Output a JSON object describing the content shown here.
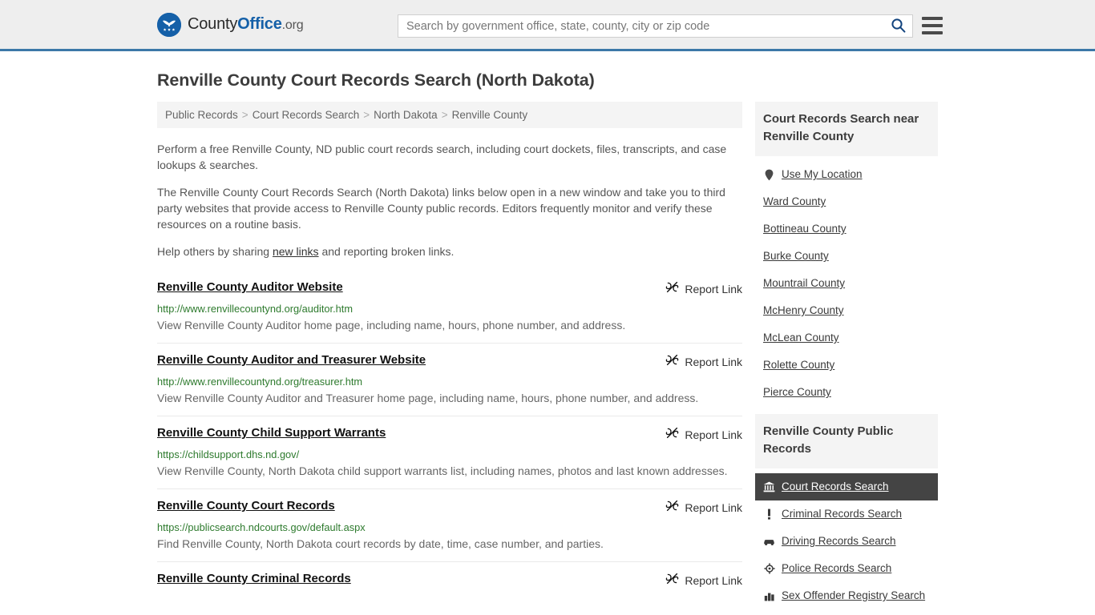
{
  "header": {
    "logo": {
      "icon": "eagle-seal-icon",
      "part1": "County",
      "part2": "Office",
      "part3": ".org"
    },
    "search": {
      "placeholder": "Search by government office, state, county, city or zip code",
      "value": "",
      "search_icon": "search-icon"
    },
    "menu_icon": "hamburger-menu-icon",
    "accent_color": "#3c78a8"
  },
  "page": {
    "title": "Renville County Court Records Search (North Dakota)"
  },
  "breadcrumb": {
    "separator": ">",
    "items": [
      {
        "label": "Public Records"
      },
      {
        "label": "Court Records Search"
      },
      {
        "label": "North Dakota"
      },
      {
        "label": "Renville County"
      }
    ]
  },
  "intro": {
    "p1": "Perform a free Renville County, ND public court records search, including court dockets, files, transcripts, and case lookups & searches.",
    "p2": "The Renville County Court Records Search (North Dakota) links below open in a new window and take you to third party websites that provide access to Renville County public records. Editors frequently monitor and verify these resources on a routine basis.",
    "p3_before": "Help others by sharing ",
    "p3_link": "new links",
    "p3_after": " and reporting broken links."
  },
  "results": {
    "report_label": "Report Link",
    "report_icon": "broken-link-icon",
    "items": [
      {
        "title": "Renville County Auditor Website",
        "url": "http://www.renvillecountynd.org/auditor.htm",
        "description": "View Renville County Auditor home page, including name, hours, phone number, and address."
      },
      {
        "title": "Renville County Auditor and Treasurer Website",
        "url": "http://www.renvillecountynd.org/treasurer.htm",
        "description": "View Renville County Auditor and Treasurer home page, including name, hours, phone number, and address."
      },
      {
        "title": "Renville County Child Support Warrants",
        "url": "https://childsupport.dhs.nd.gov/",
        "description": "View Renville County, North Dakota child support warrants list, including names, photos and last known addresses."
      },
      {
        "title": "Renville County Court Records",
        "url": "https://publicsearch.ndcourts.gov/default.aspx",
        "description": "Find Renville County, North Dakota court records by date, time, case number, and parties."
      },
      {
        "title": "Renville County Criminal Records",
        "url": "",
        "description": ""
      }
    ]
  },
  "sidebar": {
    "nearby": {
      "heading": "Court Records Search near Renville County",
      "items": [
        {
          "label": "Use My Location",
          "icon": "map-pin-icon"
        },
        {
          "label": "Ward County",
          "icon": ""
        },
        {
          "label": "Bottineau County",
          "icon": ""
        },
        {
          "label": "Burke County",
          "icon": ""
        },
        {
          "label": "Mountrail County",
          "icon": ""
        },
        {
          "label": "McHenry County",
          "icon": ""
        },
        {
          "label": "McLean County",
          "icon": ""
        },
        {
          "label": "Rolette County",
          "icon": ""
        },
        {
          "label": "Pierce County",
          "icon": ""
        }
      ]
    },
    "public_records": {
      "heading": "Renville County Public Records",
      "active_color": "#444444",
      "items": [
        {
          "label": "Court Records Search",
          "icon": "courthouse-icon",
          "active": true
        },
        {
          "label": "Criminal Records Search",
          "icon": "exclamation-icon",
          "active": false
        },
        {
          "label": "Driving Records Search",
          "icon": "car-icon",
          "active": false
        },
        {
          "label": "Police Records Search",
          "icon": "police-badge-icon",
          "active": false
        },
        {
          "label": "Sex Offender Registry Search",
          "icon": "buildings-icon",
          "active": false
        }
      ]
    }
  }
}
